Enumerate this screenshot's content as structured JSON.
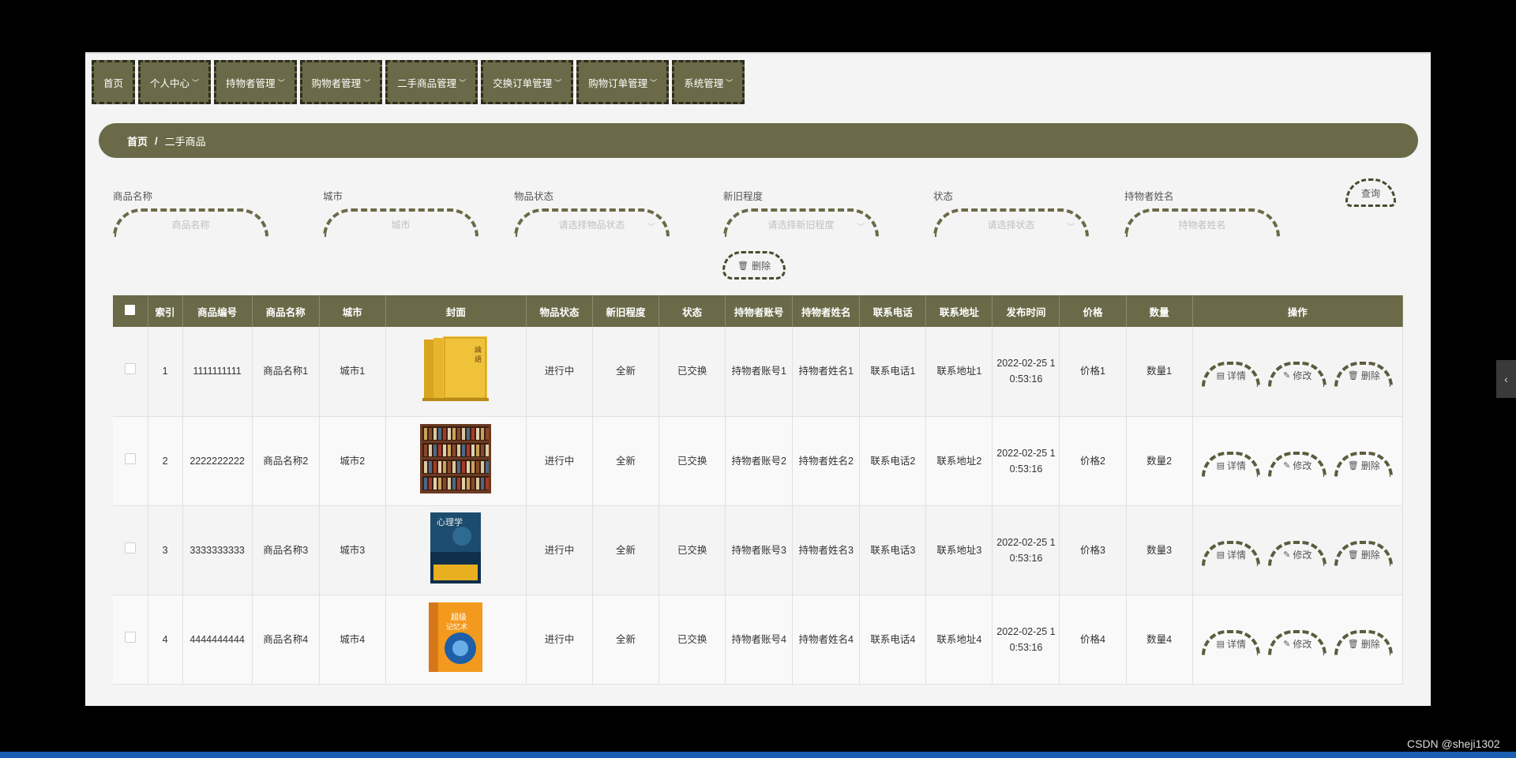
{
  "nav": [
    {
      "label": "首页",
      "dropdown": false
    },
    {
      "label": "个人中心",
      "dropdown": true
    },
    {
      "label": "持物者管理",
      "dropdown": true
    },
    {
      "label": "购物者管理",
      "dropdown": true
    },
    {
      "label": "二手商品管理",
      "dropdown": true
    },
    {
      "label": "交换订单管理",
      "dropdown": true
    },
    {
      "label": "购物订单管理",
      "dropdown": true
    },
    {
      "label": "系统管理",
      "dropdown": true
    }
  ],
  "breadcrumb": {
    "home": "首页",
    "sep": "/",
    "current": "二手商品"
  },
  "filters": [
    {
      "label": "商品名称",
      "placeholder": "商品名称",
      "select": false
    },
    {
      "label": "城市",
      "placeholder": "城市",
      "select": false
    },
    {
      "label": "物品状态",
      "placeholder": "请选择物品状态",
      "select": true
    },
    {
      "label": "新旧程度",
      "placeholder": "请选择新旧程度",
      "select": true
    },
    {
      "label": "状态",
      "placeholder": "请选择状态",
      "select": true
    },
    {
      "label": "持物者姓名",
      "placeholder": "持物者姓名",
      "select": false
    }
  ],
  "buttons": {
    "query": "查询",
    "delete": "删除"
  },
  "table": {
    "headers": [
      "索引",
      "商品编号",
      "商品名称",
      "城市",
      "封面",
      "物品状态",
      "新旧程度",
      "状态",
      "持物者账号",
      "持物者姓名",
      "联系电话",
      "联系地址",
      "发布时间",
      "价格",
      "数量",
      "操作"
    ],
    "ops": {
      "detail": "详情",
      "edit": "修改",
      "delete": "删除"
    },
    "rows": [
      {
        "idx": "1",
        "code": "1111111111",
        "name": "商品名称1",
        "city": "城市1",
        "item_status": "进行中",
        "condition": "全新",
        "status": "已交换",
        "owner_account": "持物者账号1",
        "owner_name": "持物者姓名1",
        "phone": "联系电话1",
        "address": "联系地址1",
        "time": "2022-02-25 10:53:16",
        "price": "价格1",
        "qty": "数量1",
        "cover_title": "论语"
      },
      {
        "idx": "2",
        "code": "2222222222",
        "name": "商品名称2",
        "city": "城市2",
        "item_status": "进行中",
        "condition": "全新",
        "status": "已交换",
        "owner_account": "持物者账号2",
        "owner_name": "持物者姓名2",
        "phone": "联系电话2",
        "address": "联系地址2",
        "time": "2022-02-25 10:53:16",
        "price": "价格2",
        "qty": "数量2",
        "cover_title": ""
      },
      {
        "idx": "3",
        "code": "3333333333",
        "name": "商品名称3",
        "city": "城市3",
        "item_status": "进行中",
        "condition": "全新",
        "status": "已交换",
        "owner_account": "持物者账号3",
        "owner_name": "持物者姓名3",
        "phone": "联系电话3",
        "address": "联系地址3",
        "time": "2022-02-25 10:53:16",
        "price": "价格3",
        "qty": "数量3",
        "cover_title": "心理学"
      },
      {
        "idx": "4",
        "code": "4444444444",
        "name": "商品名称4",
        "city": "城市4",
        "item_status": "进行中",
        "condition": "全新",
        "status": "已交换",
        "owner_account": "持物者账号4",
        "owner_name": "持物者姓名4",
        "phone": "联系电话4",
        "address": "联系地址4",
        "time": "2022-02-25 10:53:16",
        "price": "价格4",
        "qty": "数量4",
        "cover_title": "超级记忆术"
      }
    ]
  },
  "watermark": "CSDN @sheji1302",
  "colors": {
    "accent": "#6a6a48",
    "bg": "#f4f4f4"
  }
}
